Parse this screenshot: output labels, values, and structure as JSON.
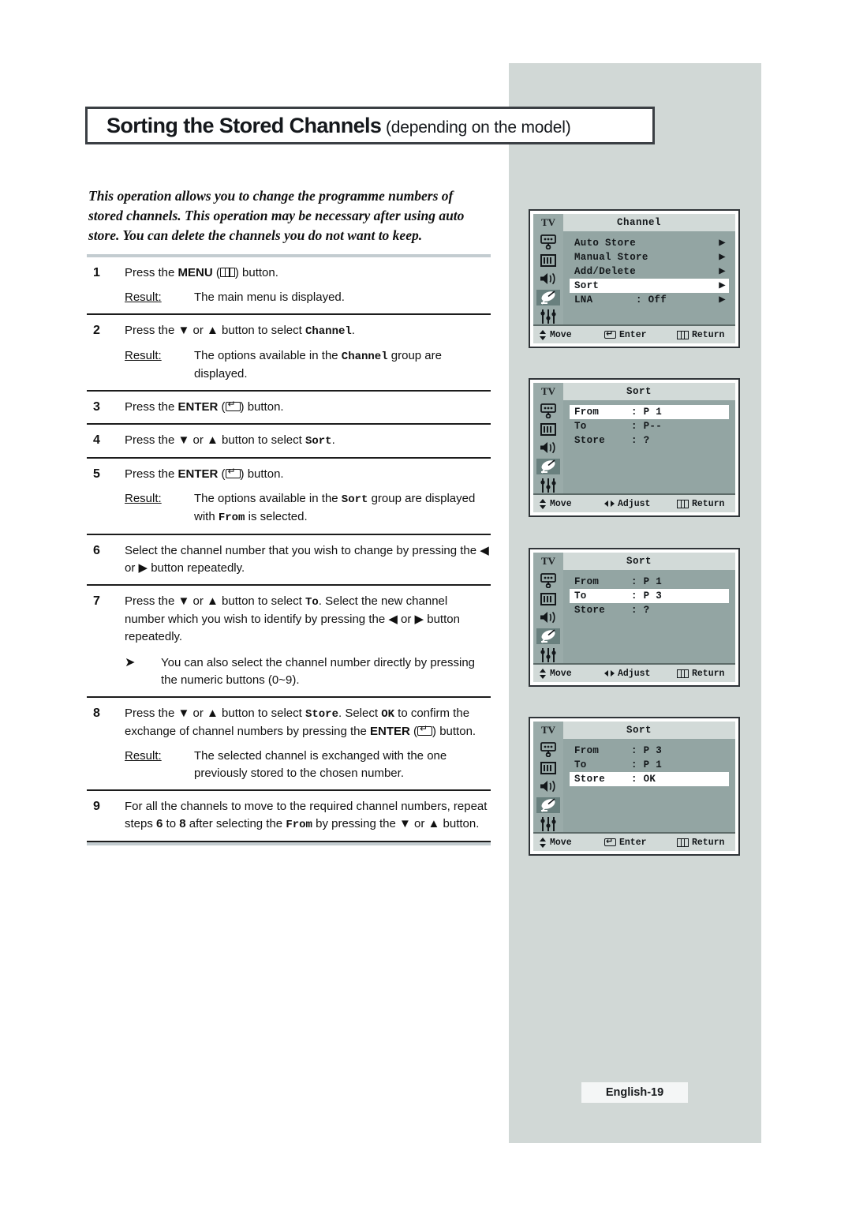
{
  "page": {
    "title_main": "Sorting the Stored Channels",
    "title_sub": " (depending on the model)",
    "intro": "This operation allows you to change the programme numbers of stored channels. This operation may be necessary after using auto store. You can delete the channels you do not want to keep.",
    "footer": "English-19"
  },
  "steps": [
    {
      "num": "1",
      "lead_a": "Press the ",
      "lead_bold": "MENU",
      "lead_b": " (",
      "lead_c": ") button.",
      "result_label": "Result:",
      "result_text": "The main menu is displayed."
    },
    {
      "num": "2",
      "lead_a": "Press the ▼ or ▲ button to select ",
      "lead_mono": "Channel",
      "lead_b": ".",
      "result_label": "Result:",
      "result_a": "The options available in the ",
      "result_mono": "Channel",
      "result_b": " group are displayed."
    },
    {
      "num": "3",
      "lead_a": "Press the ",
      "lead_bold": "ENTER",
      "lead_b": " (",
      "lead_c": ") button."
    },
    {
      "num": "4",
      "lead_a": "Press the ▼ or ▲ button to select ",
      "lead_mono": "Sort",
      "lead_b": "."
    },
    {
      "num": "5",
      "lead_a": "Press the ",
      "lead_bold": "ENTER",
      "lead_b": " (",
      "lead_c": ") button.",
      "result_label": "Result:",
      "result_a": "The options available in the ",
      "result_mono": "Sort",
      "result_b": " group are displayed with ",
      "result_mono2": "From",
      "result_c": " is selected."
    },
    {
      "num": "6",
      "lead_a": "Select the channel number that you wish to change by pressing the ◀ or ▶ button repeatedly."
    },
    {
      "num": "7",
      "lead_a": "Press the ▼ or ▲ button to select ",
      "lead_mono": "To",
      "lead_b": ". Select the new channel number which you wish to identify by pressing the ◀ or ▶ button repeatedly.",
      "note_icon": "➤",
      "note_text": "You can also select the channel number directly by pressing the numeric buttons (0~9)."
    },
    {
      "num": "8",
      "lead_a": "Press the ▼ or ▲ button to select ",
      "lead_mono": "Store",
      "lead_b": ". Select ",
      "lead_mono2": "OK",
      "lead_c": " to confirm the exchange of channel numbers by pressing the ",
      "lead_bold": "ENTER",
      "lead_d": " (",
      "lead_e": ") button.",
      "result_label": "Result:",
      "result_text": "The selected channel is exchanged with the one previously stored to the chosen number."
    },
    {
      "num": "9",
      "lead_a": "For all the channels to move to the required channel numbers, repeat steps ",
      "lead_b_bold": "6",
      "lead_b": " to ",
      "lead_c_bold": "8",
      "lead_c": " after selecting the ",
      "lead_mono": "From",
      "lead_d": " by pressing the ▼ or ▲ button."
    }
  ],
  "osd_menus": [
    {
      "tv_label": "TV",
      "title": "Channel",
      "rows": [
        {
          "label": "Auto Store",
          "value": "",
          "arrow": "▶",
          "highlight": false
        },
        {
          "label": "Manual Store",
          "value": "",
          "arrow": "▶",
          "highlight": false
        },
        {
          "label": "Add/Delete",
          "value": "",
          "arrow": "▶",
          "highlight": false
        },
        {
          "label": "Sort",
          "value": "",
          "arrow": "▶",
          "highlight": true
        },
        {
          "label": "LNA",
          "value": ": Off",
          "arrow": "▶",
          "highlight": false
        }
      ],
      "footer": {
        "move": "Move",
        "mid": "Enter",
        "mid_icon": "enter",
        "return": "Return"
      }
    },
    {
      "tv_label": "TV",
      "title": "Sort",
      "rows": [
        {
          "label": "From",
          "value": ": P 1",
          "arrow": "",
          "highlight": true
        },
        {
          "label": "To",
          "value": ": P--",
          "arrow": "",
          "highlight": false
        },
        {
          "label": "Store",
          "value": ": ?",
          "arrow": "",
          "highlight": false
        }
      ],
      "footer": {
        "move": "Move",
        "mid": "Adjust",
        "mid_icon": "leftright",
        "return": "Return"
      }
    },
    {
      "tv_label": "TV",
      "title": "Sort",
      "rows": [
        {
          "label": "From",
          "value": ": P 1",
          "arrow": "",
          "highlight": false
        },
        {
          "label": "To",
          "value": ": P 3",
          "arrow": "",
          "highlight": true
        },
        {
          "label": "Store",
          "value": ": ?",
          "arrow": "",
          "highlight": false
        }
      ],
      "footer": {
        "move": "Move",
        "mid": "Adjust",
        "mid_icon": "leftright",
        "return": "Return"
      }
    },
    {
      "tv_label": "TV",
      "title": "Sort",
      "rows": [
        {
          "label": "From",
          "value": ": P 3",
          "arrow": "",
          "highlight": false
        },
        {
          "label": "To",
          "value": ": P 1",
          "arrow": "",
          "highlight": false
        },
        {
          "label": "Store",
          "value": ": OK",
          "arrow": "",
          "highlight": true
        }
      ],
      "footer": {
        "move": "Move",
        "mid": "Enter",
        "mid_icon": "enter",
        "return": "Return"
      }
    }
  ],
  "osd_sidebar_icons": [
    "picture-icon",
    "bars-icon",
    "speaker-icon",
    "satellite-dish-icon",
    "sliders-icon"
  ],
  "colors": {
    "panel_gray": "#d1d8d6",
    "osd_body": "#93a5a3",
    "osd_bar": "#d2dad8",
    "osd_selected_icon": "#69807e",
    "rule": "#c3ccd0"
  }
}
